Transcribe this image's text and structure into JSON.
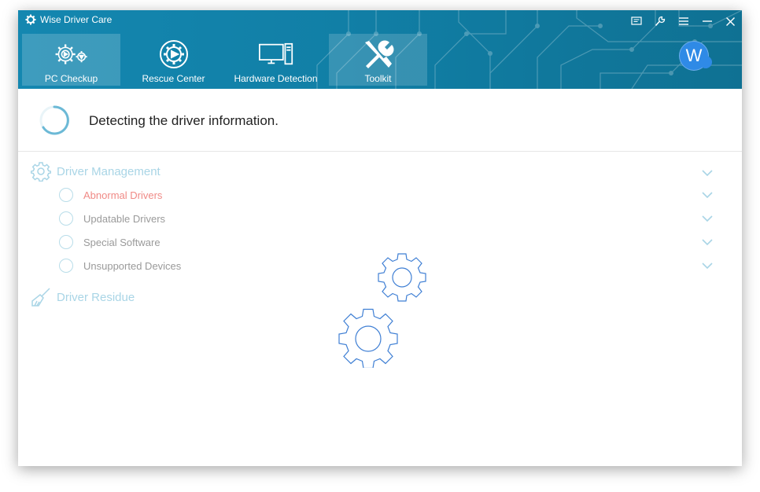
{
  "app": {
    "title": "Wise Driver Care"
  },
  "titlebar": {
    "icons": [
      "feedback-icon",
      "settings-icon",
      "menu-icon",
      "minimize-icon",
      "close-icon"
    ]
  },
  "tabs": [
    {
      "label": "PC Checkup",
      "icon": "pc-checkup-icon",
      "active": true
    },
    {
      "label": "Rescue Center",
      "icon": "rescue-center-icon",
      "active": false
    },
    {
      "label": "Hardware Detection",
      "icon": "hardware-detection-icon",
      "active": false
    },
    {
      "label": "Toolkit",
      "icon": "toolkit-icon",
      "active": false
    }
  ],
  "user": {
    "avatar_letter": "W"
  },
  "status": {
    "text": "Detecting the driver information."
  },
  "driver_management": {
    "label": "Driver Management",
    "items": [
      {
        "label": "Abnormal Drivers",
        "alert": true
      },
      {
        "label": "Updatable Drivers",
        "alert": false
      },
      {
        "label": "Special Software",
        "alert": false
      },
      {
        "label": "Unsupported Devices",
        "alert": false
      }
    ]
  },
  "driver_residue": {
    "label": "Driver Residue"
  },
  "colors": {
    "header": "#1487b0",
    "accent": "#2f8ae6",
    "alert": "#f08a86",
    "section": "#a9d5e6"
  }
}
